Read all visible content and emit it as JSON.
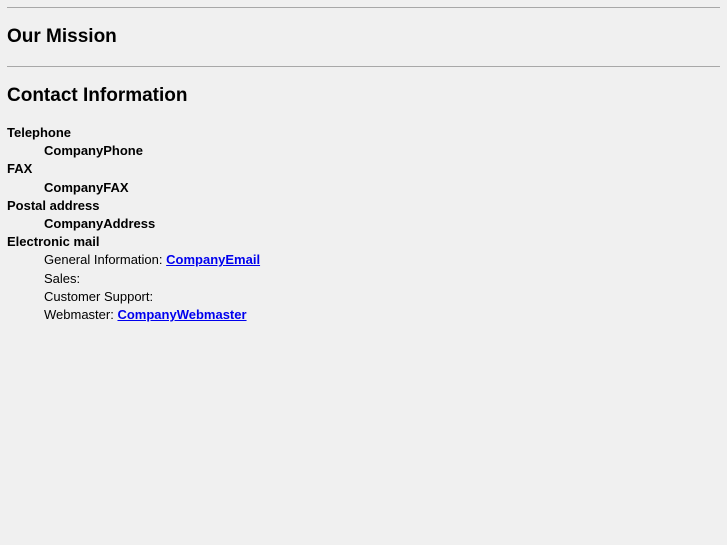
{
  "mission": {
    "heading": "Our Mission"
  },
  "contact": {
    "heading": "Contact Information",
    "telephone": {
      "label": "Telephone",
      "value": "CompanyPhone"
    },
    "fax": {
      "label": "FAX",
      "value": "CompanyFAX"
    },
    "postal": {
      "label": "Postal address",
      "value": "CompanyAddress"
    },
    "email": {
      "label": "Electronic mail",
      "general_label": "General Information:",
      "general_link": "CompanyEmail",
      "sales_label": "Sales:",
      "support_label": "Customer Support:",
      "webmaster_label": "Webmaster:",
      "webmaster_link": "CompanyWebmaster"
    }
  }
}
